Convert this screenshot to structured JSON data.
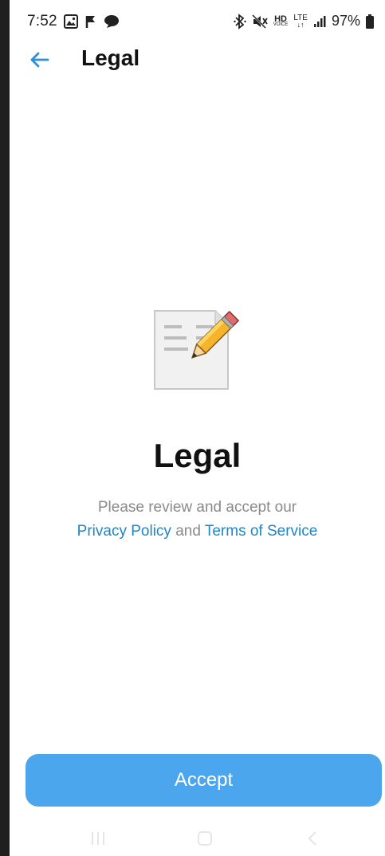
{
  "status_bar": {
    "time": "7:52",
    "left_icons": [
      "gallery-icon",
      "notification-flag-icon",
      "chat-bubble-icon"
    ],
    "hd_label": "HD",
    "hd_sub": "VOICE",
    "lte_label": "LTE",
    "battery_percent": "97%"
  },
  "header": {
    "title": "Legal"
  },
  "content": {
    "title": "Legal",
    "line1": "Please review and accept our",
    "privacy_link": "Privacy Policy",
    "and_text": " and ",
    "terms_link": "Terms of Service"
  },
  "actions": {
    "accept_label": "Accept"
  },
  "colors": {
    "accent": "#4ba6ee",
    "link": "#1f86c8",
    "body_text": "#8a8a8a"
  }
}
